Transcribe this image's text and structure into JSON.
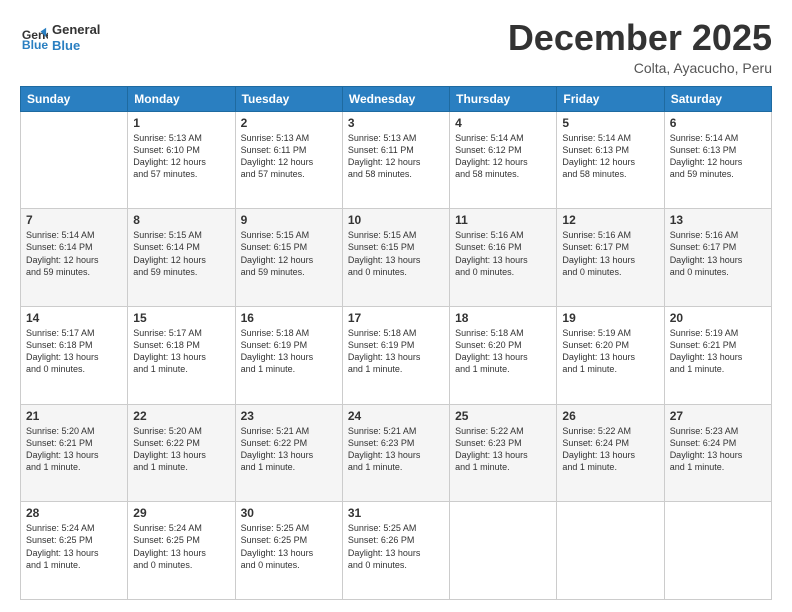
{
  "logo": {
    "line1": "General",
    "line2": "Blue"
  },
  "title": "December 2025",
  "location": "Colta, Ayacucho, Peru",
  "days_header": [
    "Sunday",
    "Monday",
    "Tuesday",
    "Wednesday",
    "Thursday",
    "Friday",
    "Saturday"
  ],
  "weeks": [
    [
      {
        "day": "",
        "info": ""
      },
      {
        "day": "1",
        "info": "Sunrise: 5:13 AM\nSunset: 6:10 PM\nDaylight: 12 hours\nand 57 minutes."
      },
      {
        "day": "2",
        "info": "Sunrise: 5:13 AM\nSunset: 6:11 PM\nDaylight: 12 hours\nand 57 minutes."
      },
      {
        "day": "3",
        "info": "Sunrise: 5:13 AM\nSunset: 6:11 PM\nDaylight: 12 hours\nand 58 minutes."
      },
      {
        "day": "4",
        "info": "Sunrise: 5:14 AM\nSunset: 6:12 PM\nDaylight: 12 hours\nand 58 minutes."
      },
      {
        "day": "5",
        "info": "Sunrise: 5:14 AM\nSunset: 6:13 PM\nDaylight: 12 hours\nand 58 minutes."
      },
      {
        "day": "6",
        "info": "Sunrise: 5:14 AM\nSunset: 6:13 PM\nDaylight: 12 hours\nand 59 minutes."
      }
    ],
    [
      {
        "day": "7",
        "info": "Sunrise: 5:14 AM\nSunset: 6:14 PM\nDaylight: 12 hours\nand 59 minutes."
      },
      {
        "day": "8",
        "info": "Sunrise: 5:15 AM\nSunset: 6:14 PM\nDaylight: 12 hours\nand 59 minutes."
      },
      {
        "day": "9",
        "info": "Sunrise: 5:15 AM\nSunset: 6:15 PM\nDaylight: 12 hours\nand 59 minutes."
      },
      {
        "day": "10",
        "info": "Sunrise: 5:15 AM\nSunset: 6:15 PM\nDaylight: 13 hours\nand 0 minutes."
      },
      {
        "day": "11",
        "info": "Sunrise: 5:16 AM\nSunset: 6:16 PM\nDaylight: 13 hours\nand 0 minutes."
      },
      {
        "day": "12",
        "info": "Sunrise: 5:16 AM\nSunset: 6:17 PM\nDaylight: 13 hours\nand 0 minutes."
      },
      {
        "day": "13",
        "info": "Sunrise: 5:16 AM\nSunset: 6:17 PM\nDaylight: 13 hours\nand 0 minutes."
      }
    ],
    [
      {
        "day": "14",
        "info": "Sunrise: 5:17 AM\nSunset: 6:18 PM\nDaylight: 13 hours\nand 0 minutes."
      },
      {
        "day": "15",
        "info": "Sunrise: 5:17 AM\nSunset: 6:18 PM\nDaylight: 13 hours\nand 1 minute."
      },
      {
        "day": "16",
        "info": "Sunrise: 5:18 AM\nSunset: 6:19 PM\nDaylight: 13 hours\nand 1 minute."
      },
      {
        "day": "17",
        "info": "Sunrise: 5:18 AM\nSunset: 6:19 PM\nDaylight: 13 hours\nand 1 minute."
      },
      {
        "day": "18",
        "info": "Sunrise: 5:18 AM\nSunset: 6:20 PM\nDaylight: 13 hours\nand 1 minute."
      },
      {
        "day": "19",
        "info": "Sunrise: 5:19 AM\nSunset: 6:20 PM\nDaylight: 13 hours\nand 1 minute."
      },
      {
        "day": "20",
        "info": "Sunrise: 5:19 AM\nSunset: 6:21 PM\nDaylight: 13 hours\nand 1 minute."
      }
    ],
    [
      {
        "day": "21",
        "info": "Sunrise: 5:20 AM\nSunset: 6:21 PM\nDaylight: 13 hours\nand 1 minute."
      },
      {
        "day": "22",
        "info": "Sunrise: 5:20 AM\nSunset: 6:22 PM\nDaylight: 13 hours\nand 1 minute."
      },
      {
        "day": "23",
        "info": "Sunrise: 5:21 AM\nSunset: 6:22 PM\nDaylight: 13 hours\nand 1 minute."
      },
      {
        "day": "24",
        "info": "Sunrise: 5:21 AM\nSunset: 6:23 PM\nDaylight: 13 hours\nand 1 minute."
      },
      {
        "day": "25",
        "info": "Sunrise: 5:22 AM\nSunset: 6:23 PM\nDaylight: 13 hours\nand 1 minute."
      },
      {
        "day": "26",
        "info": "Sunrise: 5:22 AM\nSunset: 6:24 PM\nDaylight: 13 hours\nand 1 minute."
      },
      {
        "day": "27",
        "info": "Sunrise: 5:23 AM\nSunset: 6:24 PM\nDaylight: 13 hours\nand 1 minute."
      }
    ],
    [
      {
        "day": "28",
        "info": "Sunrise: 5:24 AM\nSunset: 6:25 PM\nDaylight: 13 hours\nand 1 minute."
      },
      {
        "day": "29",
        "info": "Sunrise: 5:24 AM\nSunset: 6:25 PM\nDaylight: 13 hours\nand 0 minutes."
      },
      {
        "day": "30",
        "info": "Sunrise: 5:25 AM\nSunset: 6:25 PM\nDaylight: 13 hours\nand 0 minutes."
      },
      {
        "day": "31",
        "info": "Sunrise: 5:25 AM\nSunset: 6:26 PM\nDaylight: 13 hours\nand 0 minutes."
      },
      {
        "day": "",
        "info": ""
      },
      {
        "day": "",
        "info": ""
      },
      {
        "day": "",
        "info": ""
      }
    ]
  ]
}
